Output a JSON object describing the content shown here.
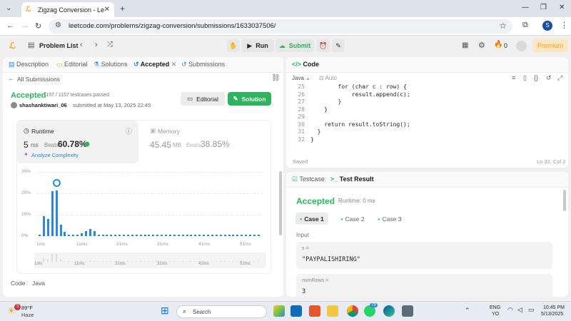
{
  "browser": {
    "tab_title": "Zigzag Conversion - LeetCode",
    "url": "leetcode.com/problems/zigzag-conversion/submissions/1633037506/",
    "profile_initial": "S"
  },
  "header": {
    "problem_list": "Problem List",
    "run": "Run",
    "submit": "Submit",
    "coins": "0",
    "premium": "Premium"
  },
  "left_tabs": [
    "Description",
    "Editorial",
    "Solutions",
    "Accepted",
    "Submissions"
  ],
  "submission": {
    "back": "All Submissions",
    "status": "Accepted",
    "testcases": "1157 / 1157 testcases passed",
    "user": "shashanktiwari_06",
    "submitted": "submitted at May 13, 2025 22:45",
    "editorial_btn": "Editorial",
    "solution_btn": "Solution"
  },
  "runtime": {
    "label": "Runtime",
    "value": "5",
    "unit": "ms",
    "beats_label": "Beats",
    "beats": "60.78%",
    "analyze": "Analyze Complexity"
  },
  "memory": {
    "label": "Memory",
    "value": "45.45",
    "unit": "MB",
    "beats_label": "Beats",
    "beats": "38.85%"
  },
  "chart_data": {
    "type": "bar",
    "y_ticks": [
      "30%",
      "20%",
      "10%",
      "0%"
    ],
    "x_ticks": [
      "1ms",
      "11ms",
      "21ms",
      "31ms",
      "41ms",
      "51ms"
    ],
    "mini_ticks": [
      "1ms",
      "11ms",
      "21ms",
      "31ms",
      "41ms",
      "51ms"
    ],
    "ylim": [
      0,
      30
    ],
    "values": [
      0.8,
      9.5,
      8,
      21,
      21.5,
      5.5,
      2,
      0.8,
      0.8,
      0.8,
      1.5,
      2.5,
      3.5,
      2.5,
      0.8,
      0.8,
      0.8,
      0.8,
      0.8,
      0.8,
      0.8,
      0.8,
      0.8,
      0.8,
      0.8,
      0.8,
      0.8,
      0.8,
      0.8,
      0.8,
      0.8,
      0.8,
      0.8,
      0.8,
      0.8,
      0.8,
      0.8,
      0.8,
      0.8,
      0.8,
      0.8,
      0.8,
      0.8,
      0.8,
      0.8,
      0.8,
      0.8,
      0.8,
      0.8,
      0.8,
      0.8,
      0.8,
      0.8
    ],
    "highlight_index": 4
  },
  "code_footer": {
    "code": "Code",
    "lang": "Java"
  },
  "code_panel": {
    "title": "Code",
    "lang": "Java",
    "auto": "Auto",
    "saved": "Saved",
    "cursor": "Ln 32, Col 2",
    "lines": [
      {
        "n": "25",
        "text": "        for (char c : row) {"
      },
      {
        "n": "26",
        "text": "            result.append(c);"
      },
      {
        "n": "27",
        "text": "        }"
      },
      {
        "n": "28",
        "text": "    }"
      },
      {
        "n": "29",
        "text": ""
      },
      {
        "n": "30",
        "text": "    return result.toString();"
      },
      {
        "n": "31",
        "text": "  }"
      },
      {
        "n": "32",
        "text": "}"
      }
    ]
  },
  "result_panel": {
    "testcase_tab": "Testcase",
    "result_tab": "Test Result",
    "status": "Accepted",
    "runtime": "Runtime: 0 ms",
    "cases": [
      "Case 1",
      "Case 2",
      "Case 3"
    ],
    "input_label": "Input",
    "s_label": "s =",
    "s_value": "\"PAYPALISHIRING\"",
    "rows_label": "numRows =",
    "rows_value": "3"
  },
  "taskbar": {
    "temp": "89°F",
    "weather": "Haze",
    "weather_badge": "3",
    "search": "Search",
    "lang1": "ENG",
    "lang2": "YO",
    "time": "10:45 PM",
    "date": "5/13/2025",
    "app_badge": "79"
  }
}
